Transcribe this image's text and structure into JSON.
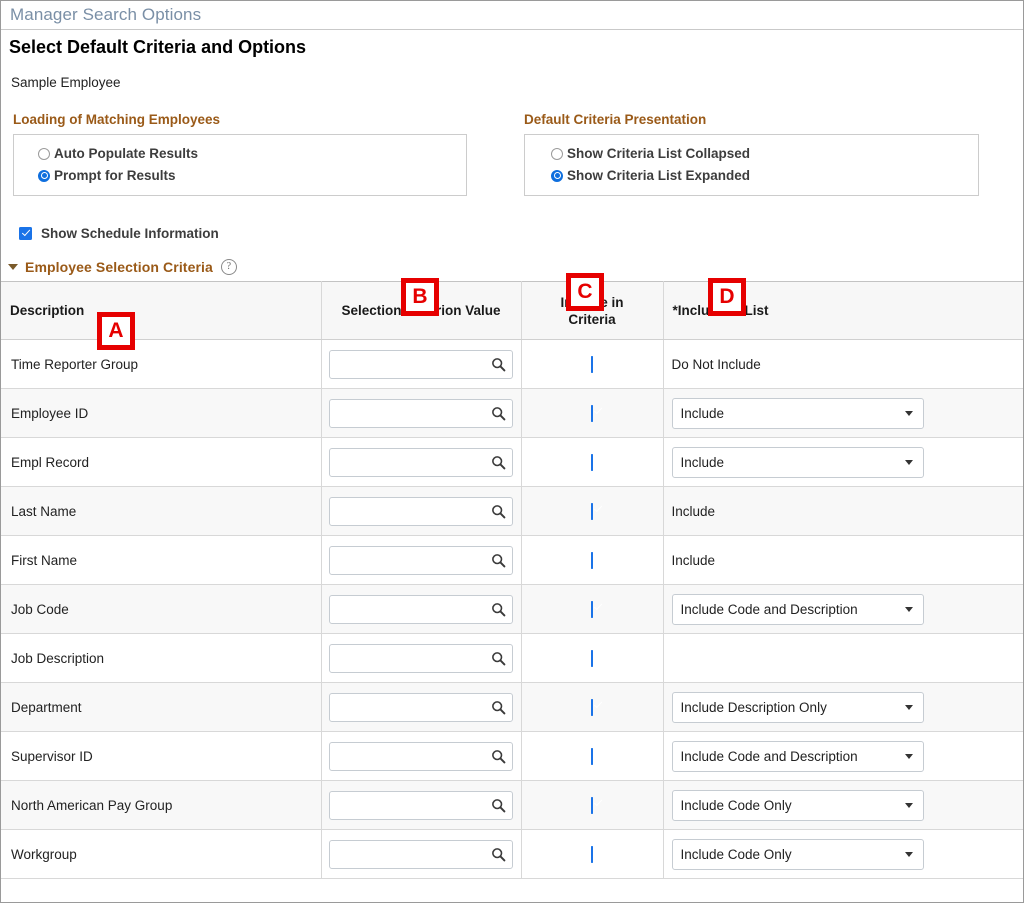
{
  "window": {
    "title": "Manager Search Options"
  },
  "page": {
    "heading": "Select Default Criteria and Options",
    "subject": "Sample Employee"
  },
  "groups": {
    "loading": {
      "legend": "Loading of Matching Employees",
      "options": [
        {
          "label": "Auto Populate Results",
          "selected": false
        },
        {
          "label": "Prompt for Results",
          "selected": true
        }
      ]
    },
    "presentation": {
      "legend": "Default Criteria Presentation",
      "options": [
        {
          "label": "Show Criteria List Collapsed",
          "selected": false
        },
        {
          "label": "Show Criteria List Expanded",
          "selected": true
        }
      ]
    }
  },
  "schedule": {
    "label": "Show Schedule Information",
    "checked": true
  },
  "section": {
    "title": "Employee Selection Criteria",
    "help_icon": "help-circle-icon",
    "expanded": true
  },
  "table": {
    "columns": [
      "Description",
      "Selection Criterion Value",
      "Include in Criteria",
      "*Include in List"
    ],
    "column_headers": {
      "description": "Description",
      "selection_criterion_value": "Selection Criterion Value",
      "include_in_criteria_line1": "Include in",
      "include_in_criteria_line2": "Criteria",
      "include_in_list": "*Include in List"
    },
    "prompt_placeholder": "",
    "prompt_icon": "search-icon",
    "rows": [
      {
        "description": "Time Reporter Group",
        "value": "",
        "include_in_criteria": true,
        "include_in_list": "Do Not Include",
        "list_is_dropdown": false
      },
      {
        "description": "Employee ID",
        "value": "",
        "include_in_criteria": true,
        "include_in_list": "Include",
        "list_is_dropdown": true
      },
      {
        "description": "Empl Record",
        "value": "",
        "include_in_criteria": true,
        "include_in_list": "Include",
        "list_is_dropdown": true
      },
      {
        "description": "Last Name",
        "value": "",
        "include_in_criteria": true,
        "include_in_list": "Include",
        "list_is_dropdown": false
      },
      {
        "description": "First Name",
        "value": "",
        "include_in_criteria": true,
        "include_in_list": "Include",
        "list_is_dropdown": false
      },
      {
        "description": "Job Code",
        "value": "",
        "include_in_criteria": true,
        "include_in_list": "Include Code and Description",
        "list_is_dropdown": true
      },
      {
        "description": "Job Description",
        "value": "",
        "include_in_criteria": true,
        "include_in_list": "",
        "list_is_dropdown": false
      },
      {
        "description": "Department",
        "value": "",
        "include_in_criteria": true,
        "include_in_list": "Include Description Only",
        "list_is_dropdown": true
      },
      {
        "description": "Supervisor ID",
        "value": "",
        "include_in_criteria": true,
        "include_in_list": "Include Code and Description",
        "list_is_dropdown": true
      },
      {
        "description": "North American Pay Group",
        "value": "",
        "include_in_criteria": true,
        "include_in_list": "Include Code Only",
        "list_is_dropdown": true
      },
      {
        "description": "Workgroup",
        "value": "",
        "include_in_criteria": true,
        "include_in_list": "Include Code Only",
        "list_is_dropdown": true
      }
    ]
  },
  "annotations": [
    {
      "id": "A",
      "label": "A",
      "target": "Description column header"
    },
    {
      "id": "B",
      "label": "B",
      "target": "Selection Criterion Value column header"
    },
    {
      "id": "C",
      "label": "C",
      "target": "Include in Criteria column header"
    },
    {
      "id": "D",
      "label": "D",
      "target": "Include in List column header"
    }
  ],
  "colors": {
    "accent_blue": "#1a73e8",
    "legend_brown": "#9a5a18",
    "annotation_red": "#e60000",
    "title_blue_gray": "#7a8fa6"
  }
}
